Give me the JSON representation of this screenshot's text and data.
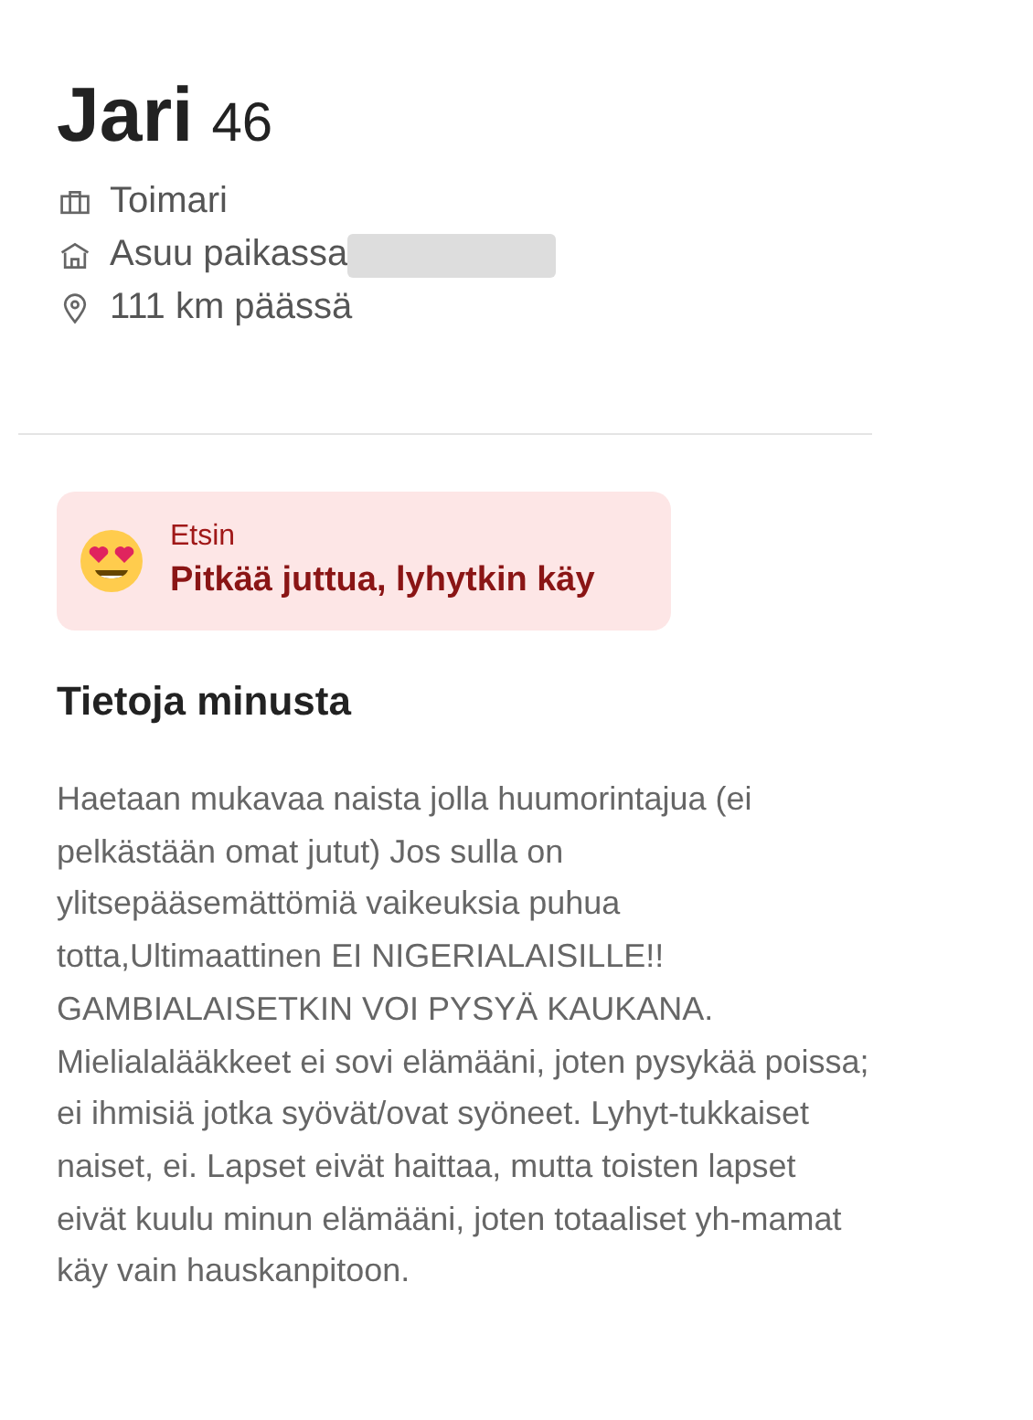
{
  "profile": {
    "name": "Jari",
    "age": "46",
    "details": [
      {
        "kind": "job",
        "text": "Toimari",
        "redacted": false
      },
      {
        "kind": "home",
        "text": "Asuu paikassa",
        "redacted": true
      },
      {
        "kind": "distance",
        "text": "111 km päässä",
        "redacted": false
      }
    ]
  },
  "looking_for": {
    "label": "Etsin",
    "value": "Pitkää juttua, lyhytkin käy"
  },
  "about": {
    "heading": "Tietoja minusta",
    "text": "Haetaan mukavaa naista jolla huumorintajua (ei pelkästään omat jutut) Jos sulla on ylitsepääsemättömiä vaikeuksia puhua totta,Ultimaattinen EI NIGERIALAISILLE!! GAMBIALAISETKIN VOI PYSYÄ KAUKANA. Mielialalääkkeet ei sovi elämääni, joten pysykää poissa; ei ihmisiä jotka syövät/ovat syöneet. Lyhyt-tukkaiset naiset, ei. Lapset eivät haittaa, mutta toisten lapset eivät kuulu minun elämääni, joten totaaliset yh-mamat käy vain hauskanpitoon."
  }
}
